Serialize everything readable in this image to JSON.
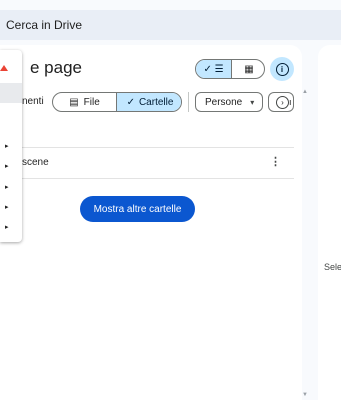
{
  "search": {
    "placeholder": "Cerca in Drive"
  },
  "page": {
    "title": "e page"
  },
  "view_toggle": {
    "list_icon": "✓ ☰",
    "grid_icon": "▦"
  },
  "info": {
    "icon": "i"
  },
  "filters": {
    "prefix": "nenti",
    "file_label": "File",
    "file_icon": "▤",
    "folders_label": "Cartelle",
    "folders_icon": "✓",
    "people_label": "Persone",
    "people_icon": "▾",
    "next_icon": "›",
    "next_partial": "ı"
  },
  "list": {
    "rows": [
      {
        "name": "scene"
      }
    ],
    "more_icon": "⋮"
  },
  "more_button": {
    "label": "Mostra altre cartelle"
  },
  "details_panel": {
    "text": "Sele"
  },
  "menu": {
    "arrow": "▸"
  }
}
